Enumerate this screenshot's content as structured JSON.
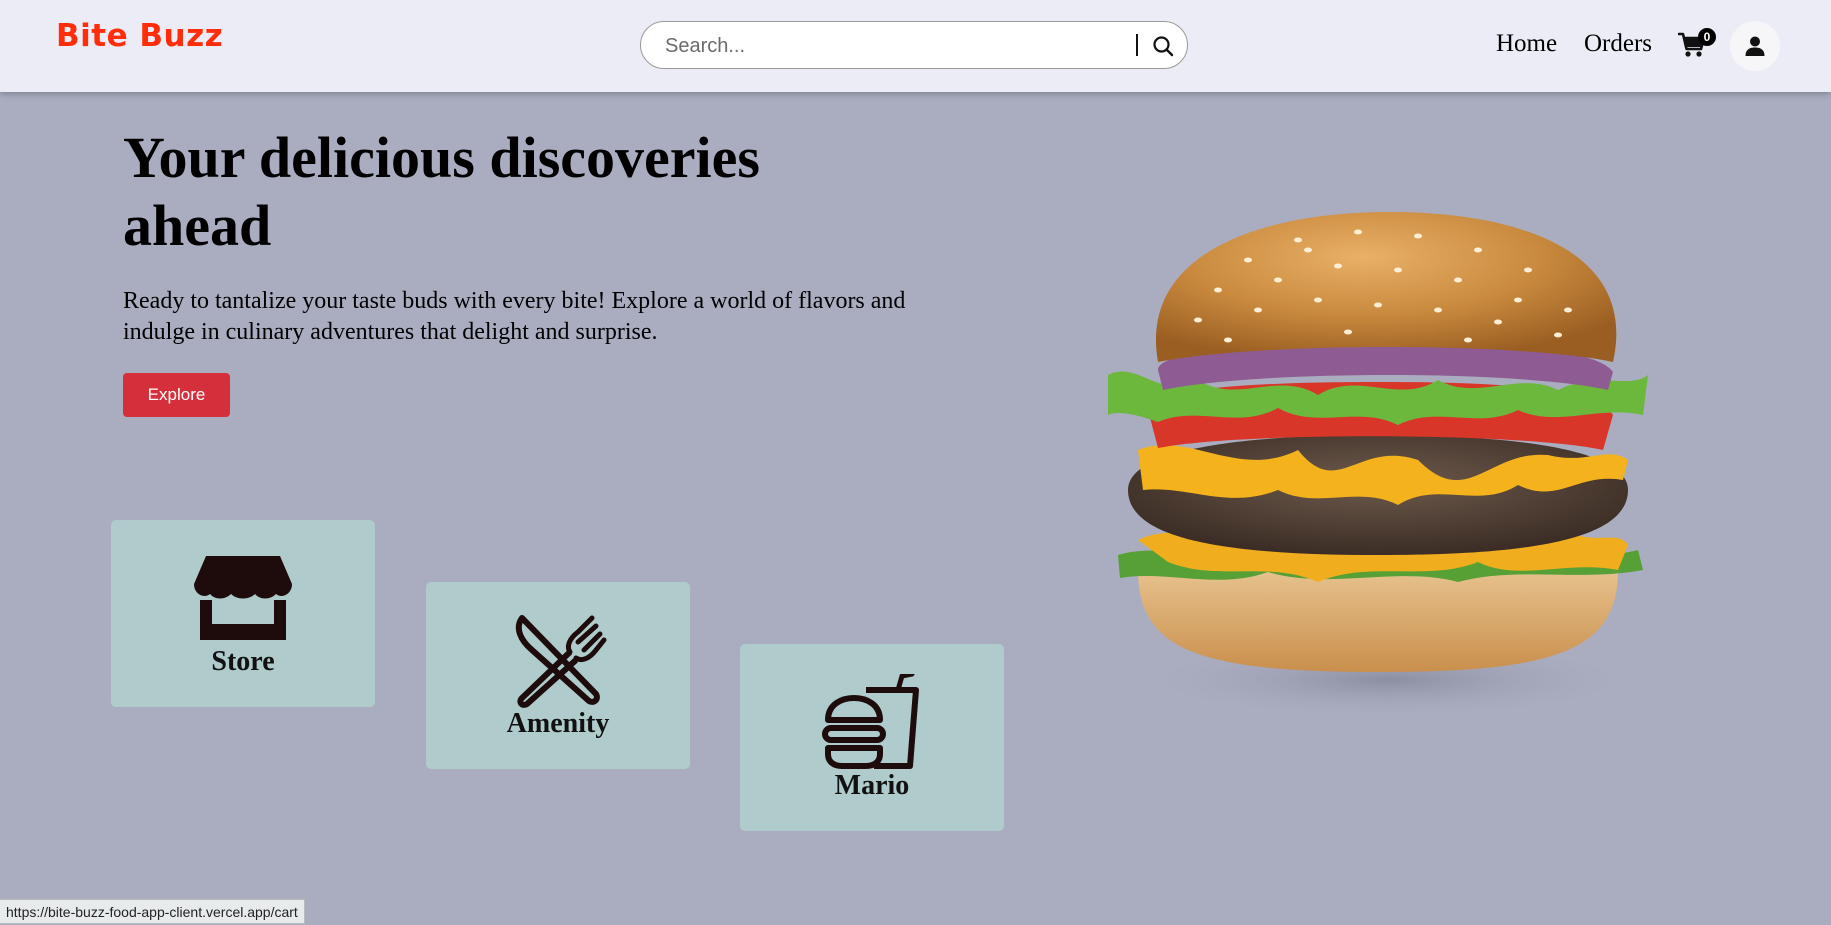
{
  "navbar": {
    "brand": "Bite Buzz",
    "search_placeholder": "Search...",
    "links": {
      "home": "Home",
      "orders": "Orders"
    },
    "cart_count": "0"
  },
  "hero": {
    "title": "Your delicious discoveries ahead",
    "description": "Ready to tantalize your taste buds with every bite! Explore a world of flavors and indulge in culinary adventures that delight and surprise.",
    "explore_label": "Explore"
  },
  "categories": [
    {
      "label": "Store",
      "icon": "store-icon"
    },
    {
      "label": "Amenity",
      "icon": "utensils-icon"
    },
    {
      "label": "Mario",
      "icon": "burger-soda-icon"
    }
  ],
  "status_url": "https://bite-buzz-food-app-client.vercel.app/cart",
  "colors": {
    "page_bg": "#aaadc0",
    "navbar_bg": "#ebecf5",
    "brand": "#ff2d0a",
    "explore_button": "#d42f3a",
    "card_bg": "#b0cbcc"
  }
}
